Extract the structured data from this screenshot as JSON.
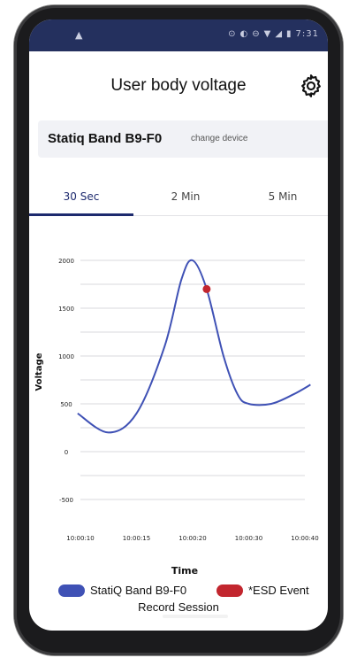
{
  "status_bar": {
    "left_icon": "warning-icon",
    "time": "7:31",
    "icons": [
      "alarm-icon",
      "data-saver-icon",
      "do-not-disturb-icon",
      "wifi-icon",
      "signal-icon",
      "battery-icon"
    ]
  },
  "header": {
    "title": "User body voltage",
    "settings_icon": "gear-icon"
  },
  "device": {
    "name": "Statiq Band B9-F0",
    "change_label": "change device"
  },
  "tabs": [
    {
      "label": "30 Sec",
      "active": true
    },
    {
      "label": "2 Min",
      "active": false
    },
    {
      "label": "5 Min",
      "active": false
    }
  ],
  "chart_data": {
    "type": "line",
    "xlabel": "Time",
    "ylabel": "Voltage",
    "x_ticks": [
      "10:00:10",
      "10:00:15",
      "10:00:20",
      "10:00:30",
      "10:00:40"
    ],
    "y_ticks": [
      2000,
      1500,
      1000,
      500,
      0,
      -500
    ],
    "ylim": [
      -500,
      2000
    ],
    "grid": true,
    "series": [
      {
        "name": "StatiQ Band B9-F0",
        "color": "#3f51b5",
        "points_tick_index": [
          [
            -0.05,
            400
          ],
          [
            0.5,
            200
          ],
          [
            1.0,
            400
          ],
          [
            1.5,
            1100
          ],
          [
            1.8,
            1800
          ],
          [
            2.0,
            2000
          ],
          [
            2.25,
            1700
          ],
          [
            2.55,
            1000
          ],
          [
            2.8,
            600
          ],
          [
            3.0,
            500
          ],
          [
            3.4,
            500
          ],
          [
            3.8,
            600
          ],
          [
            4.1,
            700
          ]
        ]
      }
    ],
    "events": [
      {
        "name": "*ESD Event",
        "color": "#c2262e",
        "tick_index": 2.25,
        "y": 1700
      }
    ]
  },
  "legend": {
    "series_label": "StatiQ Band B9-F0",
    "series_color": "#3f51b5",
    "event_label": "*ESD Event",
    "event_color": "#c2262e"
  },
  "record_session_label": "Record Session"
}
